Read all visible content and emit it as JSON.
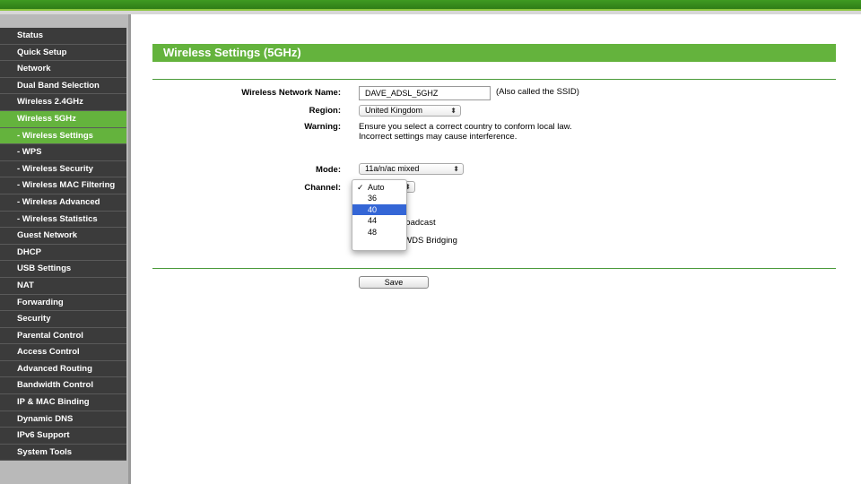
{
  "sidebar": {
    "items": [
      {
        "label": "Status",
        "state": ""
      },
      {
        "label": "Quick Setup",
        "state": ""
      },
      {
        "label": "Network",
        "state": ""
      },
      {
        "label": "Dual Band Selection",
        "state": ""
      },
      {
        "label": "Wireless 2.4GHz",
        "state": ""
      },
      {
        "label": "Wireless 5GHz",
        "state": "active"
      },
      {
        "label": "- Wireless Settings",
        "state": "sub-active"
      },
      {
        "label": "- WPS",
        "state": ""
      },
      {
        "label": "- Wireless Security",
        "state": ""
      },
      {
        "label": "- Wireless MAC Filtering",
        "state": ""
      },
      {
        "label": "- Wireless Advanced",
        "state": ""
      },
      {
        "label": "- Wireless Statistics",
        "state": ""
      },
      {
        "label": "Guest Network",
        "state": ""
      },
      {
        "label": "DHCP",
        "state": ""
      },
      {
        "label": "USB Settings",
        "state": ""
      },
      {
        "label": "NAT",
        "state": ""
      },
      {
        "label": "Forwarding",
        "state": ""
      },
      {
        "label": "Security",
        "state": ""
      },
      {
        "label": "Parental Control",
        "state": ""
      },
      {
        "label": "Access Control",
        "state": ""
      },
      {
        "label": "Advanced Routing",
        "state": ""
      },
      {
        "label": "Bandwidth Control",
        "state": ""
      },
      {
        "label": "IP & MAC Binding",
        "state": ""
      },
      {
        "label": "Dynamic DNS",
        "state": ""
      },
      {
        "label": "IPv6 Support",
        "state": ""
      },
      {
        "label": "System Tools",
        "state": ""
      }
    ]
  },
  "page": {
    "title": "Wireless Settings (5GHz)"
  },
  "form": {
    "ssid_label": "Wireless Network Name:",
    "ssid_value": "DAVE_ADSL_5GHZ",
    "ssid_hint": "(Also called the SSID)",
    "region_label": "Region:",
    "region_value": "United Kingdom",
    "warning_label": "Warning:",
    "warning_line1": "Ensure you select a correct country to conform local law.",
    "warning_line2": "Incorrect settings may cause interference.",
    "mode_label": "Mode:",
    "mode_value": "11a/n/ac mixed",
    "channel_label": "Channel:",
    "ssid_broadcast_label": "SSID Broadcast",
    "wds_label": "Enable WDS Bridging",
    "save_label": "Save"
  },
  "channel_dropdown": {
    "checkmark": "✓",
    "options": [
      "Auto",
      "36",
      "40",
      "44",
      "48"
    ],
    "checked": "Auto",
    "highlighted": "40"
  },
  "colors": {
    "accent_green": "#64b33d",
    "nav_dark": "#3b3b3b",
    "dropdown_highlight": "#3466d6"
  }
}
